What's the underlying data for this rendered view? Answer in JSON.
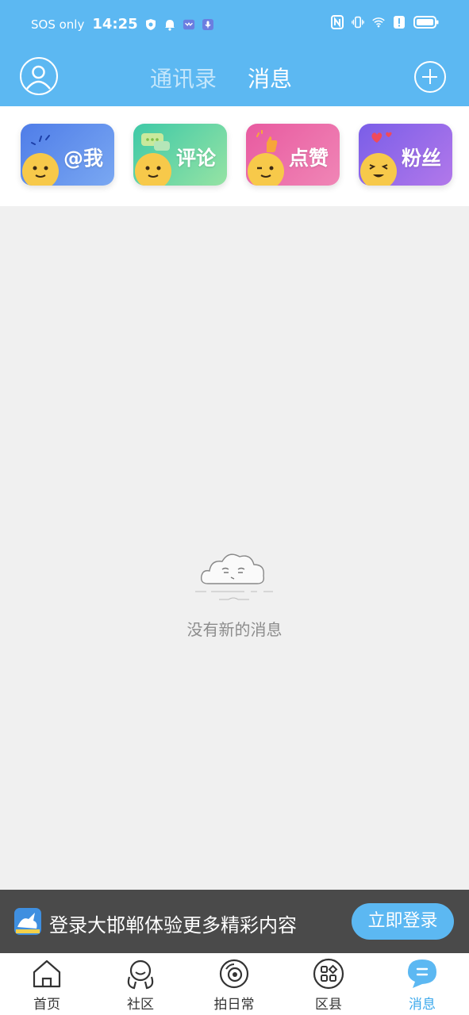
{
  "status_bar": {
    "carrier": "SOS only",
    "time": "14:25"
  },
  "header": {
    "tabs": [
      {
        "label": "通讯录",
        "active": false
      },
      {
        "label": "消息",
        "active": true
      }
    ]
  },
  "categories": [
    {
      "label": "@我"
    },
    {
      "label": "评论"
    },
    {
      "label": "点赞"
    },
    {
      "label": "粉丝"
    }
  ],
  "empty_state": {
    "text": "没有新的消息"
  },
  "login_banner": {
    "text": "登录大邯郸体验更多精彩内容",
    "button": "立即登录"
  },
  "bottom_nav": [
    {
      "label": "首页",
      "icon": "home-icon",
      "active": false
    },
    {
      "label": "社区",
      "icon": "community-icon",
      "active": false
    },
    {
      "label": "拍日常",
      "icon": "camera-icon",
      "active": false
    },
    {
      "label": "区县",
      "icon": "county-grid-icon",
      "active": false
    },
    {
      "label": "消息",
      "icon": "message-icon",
      "active": true
    }
  ],
  "colors": {
    "brand_blue": "#5cb8f2",
    "active_nav": "#3aa8ec",
    "background": "#f0f0f0"
  }
}
